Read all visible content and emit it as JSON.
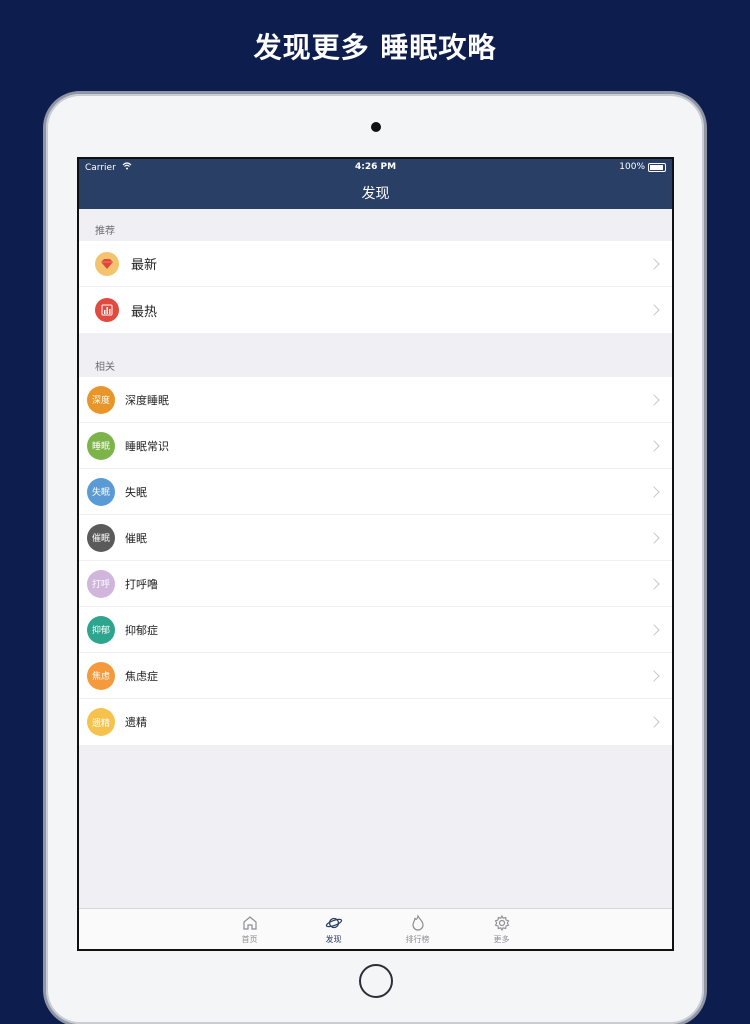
{
  "headline": "发现更多 睡眠攻略",
  "status_bar": {
    "carrier": "Carrier",
    "time": "4:26 PM",
    "battery": "100%"
  },
  "nav": {
    "title": "发现"
  },
  "sections": [
    {
      "header": "推荐",
      "items": [
        {
          "label": "最新",
          "icon": "gem-icon",
          "color": "#f3c46d"
        },
        {
          "label": "最热",
          "icon": "bar-chart-icon",
          "color": "#e04a3f"
        }
      ]
    },
    {
      "header": "相关",
      "items": [
        {
          "label": "深度睡眠",
          "badge": "深度",
          "color": "#e8962a"
        },
        {
          "label": "睡眠常识",
          "badge": "睡眠",
          "color": "#7db44a"
        },
        {
          "label": "失眠",
          "badge": "失眠",
          "color": "#5b9bd5"
        },
        {
          "label": "催眠",
          "badge": "催眠",
          "color": "#5a5a5a"
        },
        {
          "label": "打呼噜",
          "badge": "打呼",
          "color": "#d0b6dc"
        },
        {
          "label": "抑郁症",
          "badge": "抑郁",
          "color": "#2ea58f"
        },
        {
          "label": "焦虑症",
          "badge": "焦虑",
          "color": "#f59a3c"
        },
        {
          "label": "遗精",
          "badge": "遗精",
          "color": "#f6c24e"
        }
      ]
    }
  ],
  "tabbar": [
    {
      "label": "首页",
      "icon": "home-icon",
      "active": false
    },
    {
      "label": "发现",
      "icon": "planet-icon",
      "active": true
    },
    {
      "label": "排行榜",
      "icon": "flame-icon",
      "active": false
    },
    {
      "label": "更多",
      "icon": "gear-icon",
      "active": false
    }
  ],
  "colors": {
    "background": "#0d1d4d",
    "navbar": "#2a3f66",
    "accent": "#2a3f66"
  }
}
